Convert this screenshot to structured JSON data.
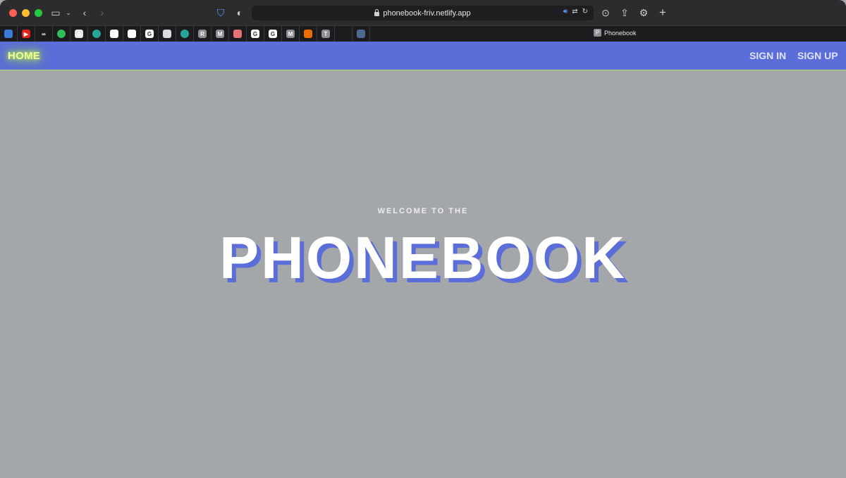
{
  "browser": {
    "url": "phonebook-friv.netlify.app",
    "tab_title": "Phonebook",
    "tab_letter": "P",
    "favorites": [
      {
        "icon": "finder-icon",
        "color": "#3d7bd9",
        "letter": ""
      },
      {
        "icon": "youtube-icon",
        "color": "#e62117",
        "letter": "▶"
      },
      {
        "icon": "link-icon",
        "color": "#1c1c1e",
        "letter": "∞"
      },
      {
        "icon": "spotify-icon",
        "color": "#2ebd59",
        "letter": ""
      },
      {
        "icon": "pdf-icon",
        "color": "#e8e8e8",
        "letter": "A"
      },
      {
        "icon": "teal-dot-icon",
        "color": "#26a69a",
        "letter": ""
      },
      {
        "icon": "github-icon",
        "color": "#ffffff",
        "letter": ""
      },
      {
        "icon": "github-icon",
        "color": "#ffffff",
        "letter": ""
      },
      {
        "icon": "google-icon",
        "color": "#ffffff",
        "letter": "G"
      },
      {
        "icon": "settings-icon",
        "color": "#d9dde3",
        "letter": ""
      },
      {
        "icon": "teal-dot-icon",
        "color": "#26a69a",
        "letter": ""
      },
      {
        "icon": "r-icon",
        "color": "#8e8e93",
        "letter": "R"
      },
      {
        "icon": "m-icon",
        "color": "#8e8e93",
        "letter": "M"
      },
      {
        "icon": "app-icon",
        "color": "#e57373",
        "letter": ""
      },
      {
        "icon": "google-icon",
        "color": "#ffffff",
        "letter": "G"
      },
      {
        "icon": "google-icon",
        "color": "#ffffff",
        "letter": "G"
      },
      {
        "icon": "m-icon",
        "color": "#8e8e93",
        "letter": "M"
      },
      {
        "icon": "orange-icon",
        "color": "#ef6c00",
        "letter": ""
      },
      {
        "icon": "t-icon",
        "color": "#8e8e93",
        "letter": "T"
      },
      {
        "icon": "logo-icon",
        "color": "#1c1c1e",
        "letter": ""
      },
      {
        "icon": "photo-icon",
        "color": "#4a6b8a",
        "letter": ""
      }
    ]
  },
  "nav": {
    "home": "HOME",
    "sign_in": "SIGN IN",
    "sign_up": "SIGN UP"
  },
  "hero": {
    "welcome": "WELCOME TO THE",
    "title": "PHONEBOOK"
  },
  "colors": {
    "nav_bg": "#5a6dd8",
    "page_bg": "#a4a7aa",
    "title_shadow": "#5a6dd8",
    "home_glow": "#caff4d"
  }
}
